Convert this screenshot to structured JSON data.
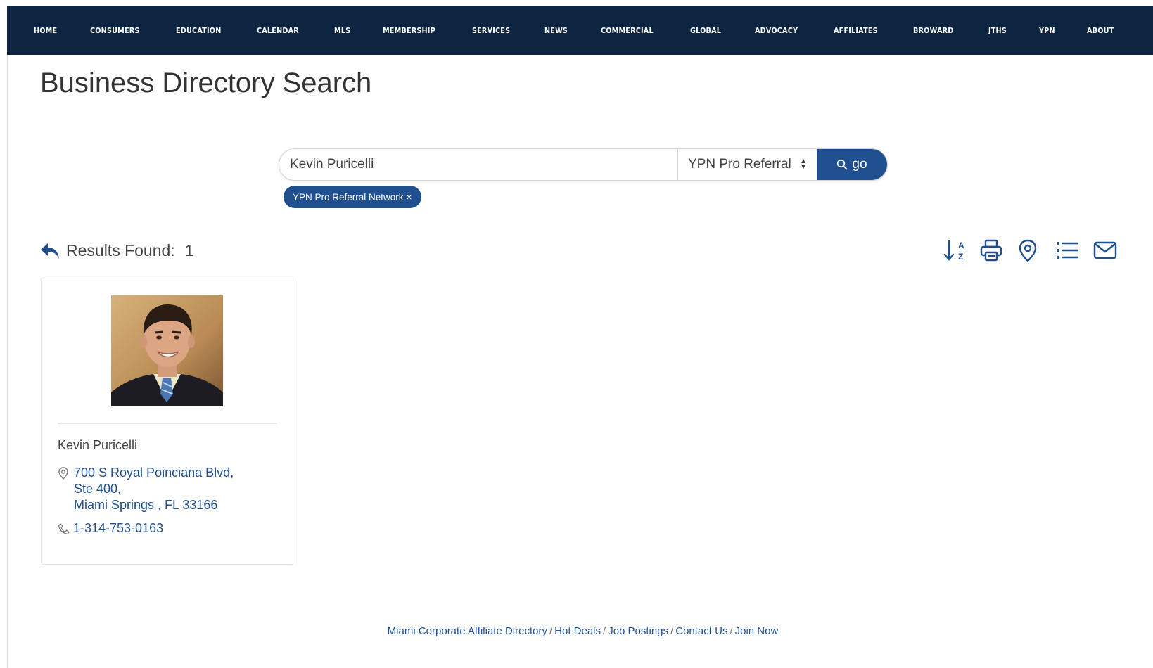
{
  "nav": {
    "items": [
      "HOME",
      "CONSUMERS",
      "EDUCATION",
      "CALENDAR",
      "MLS",
      "MEMBERSHIP",
      "SERVICES",
      "NEWS",
      "COMMERCIAL",
      "GLOBAL",
      "ADVOCACY",
      "AFFILIATES",
      "BROWARD",
      "JTHS",
      "YPN",
      "ABOUT"
    ]
  },
  "page": {
    "title": "Business Directory Search"
  },
  "search": {
    "query": "Kevin Puricelli",
    "category_selected": "YPN Pro Referral",
    "go_label": "go",
    "active_filter": "YPN Pro Referral Network",
    "filter_close": "×"
  },
  "results": {
    "label": "Results Found:",
    "count": "1"
  },
  "toolbar": {
    "icons": [
      "sort-az-icon",
      "print-icon",
      "map-pin-icon",
      "list-view-icon",
      "email-icon"
    ]
  },
  "card": {
    "name": "Kevin Puricelli",
    "address_line1": "700 S Royal Poinciana Blvd,",
    "address_line2": "Ste 400,",
    "address_line3": "Miami Springs , FL 33166",
    "phone": "1-314-753-0163"
  },
  "footer": {
    "links": [
      "Miami Corporate Affiliate Directory",
      "Hot Deals",
      "Job Postings",
      "Contact Us",
      "Join Now"
    ],
    "separator": "/"
  },
  "colors": {
    "nav_bg": "#0d2540",
    "accent": "#1f4f8f"
  }
}
